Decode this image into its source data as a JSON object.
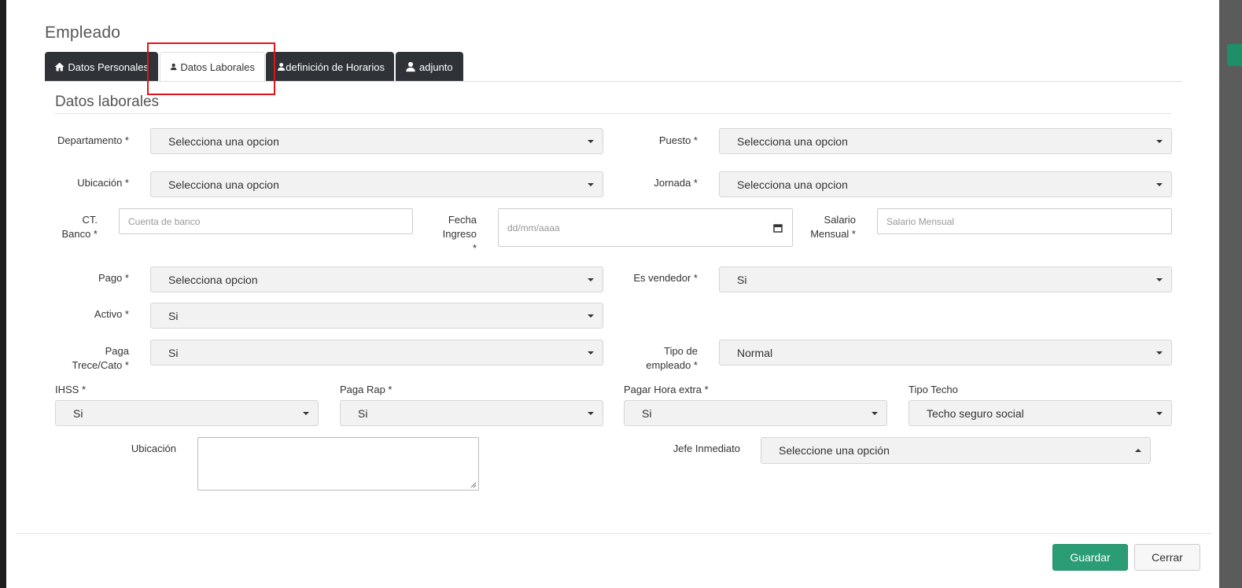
{
  "modal": {
    "title": "Empleado"
  },
  "tabs": [
    {
      "label": "Datos Personales",
      "icon": "home-icon"
    },
    {
      "label": "Datos Laborales",
      "icon": "user-icon"
    },
    {
      "label": "definición de Horarios",
      "icon": "user-icon"
    },
    {
      "label": "adjunto",
      "icon": "user-icon"
    }
  ],
  "active_tab": "Datos Laborales",
  "section": {
    "title": "Datos laborales"
  },
  "fields": {
    "departamento": {
      "label": "Departamento *",
      "value": "Selecciona una opcion"
    },
    "puesto": {
      "label": "Puesto *",
      "value": "Selecciona una opcion"
    },
    "ubicacion_select": {
      "label": "Ubicación *",
      "value": "Selecciona una opcion"
    },
    "jornada": {
      "label": "Jornada *",
      "value": "Selecciona una opcion"
    },
    "ct_banco": {
      "label": "CT. Banco *",
      "placeholder": "Cuenta de banco"
    },
    "fecha_ingreso": {
      "label": "Fecha Ingreso *",
      "placeholder": "dd/mm/aaaa"
    },
    "salario_mensual": {
      "label": "Salario Mensual *",
      "placeholder": "Salario Mensual"
    },
    "pago": {
      "label": "Pago *",
      "value": "Selecciona opcion"
    },
    "es_vendedor": {
      "label": "Es vendedor *",
      "value": "Si"
    },
    "activo": {
      "label": "Activo *",
      "value": "Si"
    },
    "paga_trece_cato": {
      "label": "Paga Trece/Cato *",
      "value": "Si"
    },
    "tipo_empleado": {
      "label": "Tipo de empleado *",
      "value": "Normal"
    },
    "ihss": {
      "label": "IHSS *",
      "value": "Si"
    },
    "paga_rap": {
      "label": "Paga Rap *",
      "value": "Si"
    },
    "pagar_hora_extra": {
      "label": "Pagar Hora extra *",
      "value": "Si"
    },
    "tipo_techo": {
      "label": "Tipo Techo",
      "value": "Techo seguro social"
    },
    "ubicacion_text": {
      "label": "Ubicación",
      "value": ""
    },
    "jefe_inmediato": {
      "label": "Jefe Inmediato",
      "value": "Seleccione una opción"
    }
  },
  "footer": {
    "save_label": "Guardar",
    "close_label": "Cerrar"
  },
  "colors": {
    "accent": "#2a9d75",
    "tab_dark": "#2f3338",
    "highlight": "#e2131b"
  }
}
